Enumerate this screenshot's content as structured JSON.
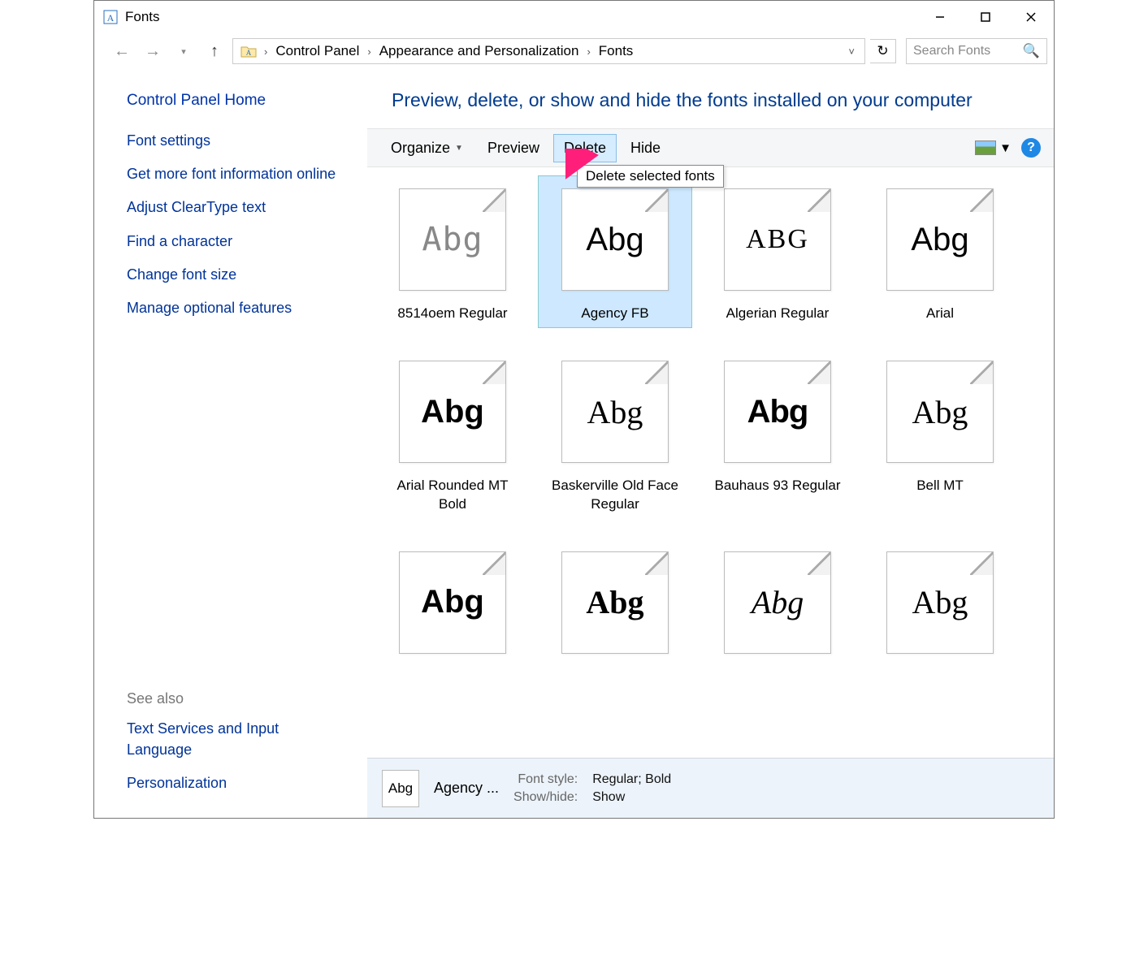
{
  "window": {
    "title": "Fonts"
  },
  "breadcrumbs": {
    "items": [
      "Control Panel",
      "Appearance and Personalization",
      "Fonts"
    ]
  },
  "search": {
    "placeholder": "Search Fonts"
  },
  "sidebar": {
    "home": "Control Panel Home",
    "links": [
      "Font settings",
      "Get more font information online",
      "Adjust ClearType text",
      "Find a character",
      "Change font size",
      "Manage optional features"
    ],
    "see_also_header": "See also",
    "see_also": [
      "Text Services and Input Language",
      "Personalization"
    ]
  },
  "page": {
    "heading": "Preview, delete, or show and hide the fonts installed on your computer"
  },
  "toolbar": {
    "organize": "Organize",
    "preview": "Preview",
    "delete": "Delete",
    "hide": "Hide"
  },
  "tooltip": {
    "delete": "Delete selected fonts"
  },
  "fonts": {
    "items": [
      {
        "name": "8514oem Regular",
        "sample": "Abg",
        "class": "fs-pixel",
        "stack": false
      },
      {
        "name": "Agency FB",
        "sample": "Abg",
        "class": "fs-agency",
        "stack": true,
        "selected": true
      },
      {
        "name": "Algerian Regular",
        "sample": "ABG",
        "class": "fs-algerian",
        "stack": false
      },
      {
        "name": "Arial",
        "sample": "Abg",
        "class": "fs-arial",
        "stack": true
      },
      {
        "name": "Arial Rounded MT Bold",
        "sample": "Abg",
        "class": "fs-arialround",
        "stack": false
      },
      {
        "name": "Baskerville Old Face Regular",
        "sample": "Abg",
        "class": "fs-bask",
        "stack": false
      },
      {
        "name": "Bauhaus 93 Regular",
        "sample": "Abg",
        "class": "fs-bauhaus",
        "stack": false
      },
      {
        "name": "Bell MT",
        "sample": "Abg",
        "class": "fs-bell",
        "stack": true
      },
      {
        "name": "",
        "sample": "Abg",
        "class": "fs-berlin",
        "stack": true
      },
      {
        "name": "",
        "sample": "Abg",
        "class": "fs-bernard",
        "stack": false
      },
      {
        "name": "",
        "sample": "Abg",
        "class": "fs-script",
        "stack": false
      },
      {
        "name": "",
        "sample": "Abg",
        "class": "fs-generic",
        "stack": true
      }
    ]
  },
  "details": {
    "name": "Agency ...",
    "thumb_sample": "Abg",
    "props": [
      {
        "label": "Font style:",
        "value": "Regular; Bold"
      },
      {
        "label": "Show/hide:",
        "value": "Show"
      }
    ]
  }
}
